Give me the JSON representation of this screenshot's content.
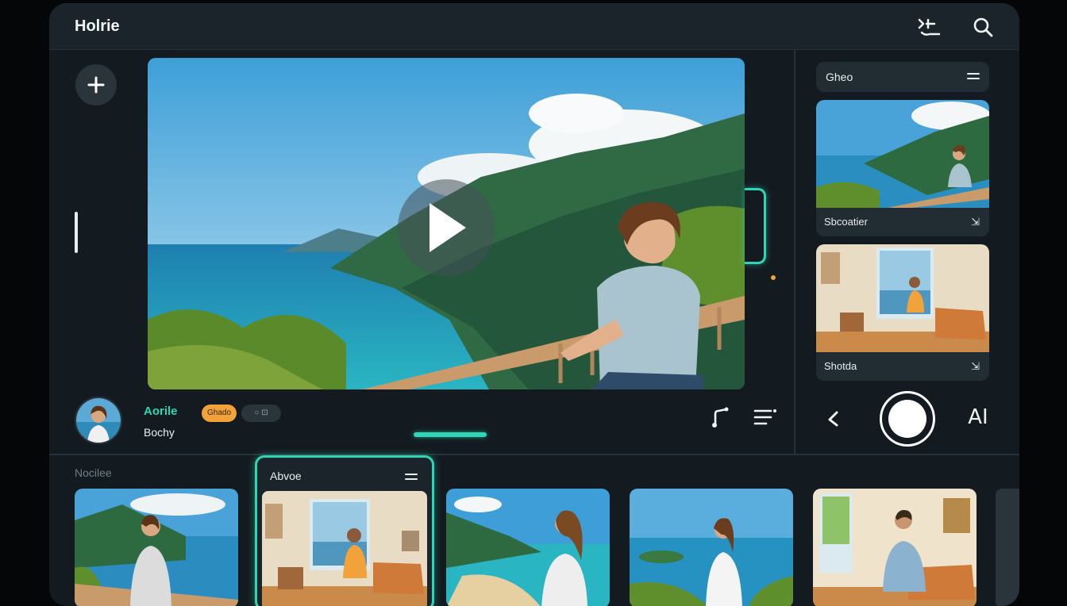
{
  "app": {
    "title": "Holrie"
  },
  "header": {
    "icons": [
      "queue-icon",
      "search-icon"
    ]
  },
  "left_rail": {
    "add_icon": "plus-icon"
  },
  "player": {
    "play_icon": "play-icon"
  },
  "channel": {
    "name": "Aorile",
    "subtitle": "Bochy",
    "badge_primary": "Ghado",
    "badge_secondary": "○ ⊡"
  },
  "player_controls": {
    "icons": [
      "music-note-icon",
      "playlist-icon"
    ]
  },
  "side_panel": {
    "header": "Gheo",
    "cards": [
      {
        "label": "Sbcoatier",
        "action_glyph": "⇲"
      },
      {
        "label": "Shotda",
        "action_glyph": "⇲"
      }
    ]
  },
  "capture_controls": {
    "back_icon": "back-arrow-icon",
    "shutter_icon": "shutter-icon",
    "ai_label": "AI"
  },
  "strip": {
    "label": "Nocilee",
    "active_tile_label": "Abvoe"
  },
  "colors": {
    "accent": "#2fd6b5",
    "badge": "#f2a23a",
    "panel": "#141b20",
    "surface": "#222c33"
  }
}
